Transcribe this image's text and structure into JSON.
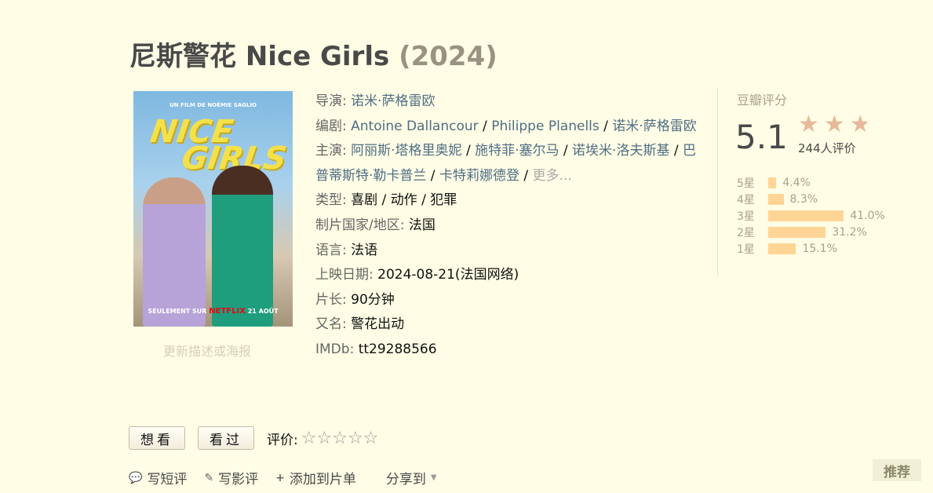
{
  "movie": {
    "title": "尼斯警花 Nice Girls",
    "year": "(2024)"
  },
  "poster": {
    "tagline": "UN FILM DE NOÉMIE SAGLIO",
    "title_line1": "NICE",
    "title_line2": "GIRLS",
    "bottom_prefix": "SEULEMENT SUR",
    "bottom_brand": "NETFLIX",
    "bottom_date": "21 AOÛT",
    "update_link": "更新描述或海报"
  },
  "info": {
    "director_label": "导演",
    "director": "诺米·萨格雷欧",
    "writer_label": "编剧",
    "writers": [
      "Antoine Dallancour",
      "Philippe Planells",
      "诺米·萨格雷欧"
    ],
    "cast_label": "主演",
    "cast": [
      "阿丽斯·塔格里奥妮",
      "施特菲·塞尔马",
      "诺埃米·洛夫斯基",
      "巴普蒂斯特·勒卡普兰",
      "卡特莉娜德登"
    ],
    "cast_more": "更多...",
    "genre_label": "类型",
    "genres": [
      "喜剧",
      "动作",
      "犯罪"
    ],
    "country_label": "制片国家/地区",
    "country": "法国",
    "language_label": "语言",
    "language": "法语",
    "release_label": "上映日期",
    "release": "2024-08-21(法国网络)",
    "runtime_label": "片长",
    "runtime": "90分钟",
    "aka_label": "又名",
    "aka": "警花出动",
    "imdb_label": "IMDb",
    "imdb": "tt29288566"
  },
  "rating": {
    "label": "豆瓣评分",
    "score": "5.1",
    "stars": 2.5,
    "count": "244人评价",
    "breakdown": [
      {
        "label": "5星",
        "percent": "4.4%",
        "value": 4.4
      },
      {
        "label": "4星",
        "percent": "8.3%",
        "value": 8.3
      },
      {
        "label": "3星",
        "percent": "41.0%",
        "value": 41.0
      },
      {
        "label": "2星",
        "percent": "31.2%",
        "value": 31.2
      },
      {
        "label": "1星",
        "percent": "15.1%",
        "value": 15.1
      }
    ]
  },
  "actions": {
    "want_label": "想看",
    "seen_label": "看过",
    "rate_label": "评价:",
    "short_review": "写短评",
    "review": "写影评",
    "add_list": "添加到片单",
    "share": "分享到",
    "recommend": "推荐"
  },
  "colors": {
    "background": "#fffde5",
    "link": "#4f6e85",
    "bar": "#ffd596",
    "star": "#e7b99a"
  }
}
